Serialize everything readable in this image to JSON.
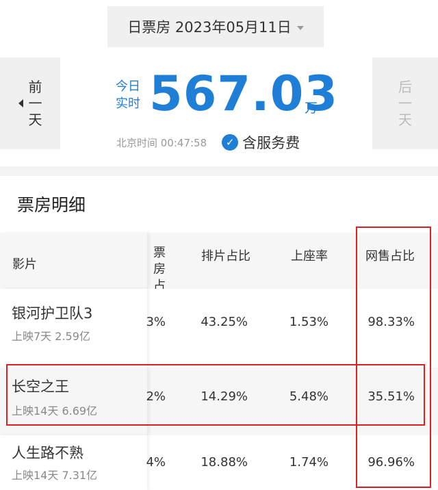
{
  "header": {
    "date_label": "日票房 2023年05月11日"
  },
  "nav": {
    "prev": [
      "前",
      "一",
      "天"
    ],
    "next": [
      "后",
      "一",
      "天"
    ]
  },
  "realtime": {
    "label_line1": "今日",
    "label_line2": "实时",
    "value": "567.03",
    "unit": "万",
    "time": "北京时间 00:47:58",
    "fee_note": "含服务费"
  },
  "section": {
    "title": "票房明细"
  },
  "table": {
    "columns": {
      "film": "影片",
      "boxoffice_share_clipped_line1": "票房",
      "boxoffice_share_clipped_line2": "占比",
      "screening_share": "排片占比",
      "occupancy": "上座率",
      "online_share": "网售占比"
    },
    "rows": [
      {
        "name": "银河护卫队3",
        "sub": "上映7天 2.59亿",
        "boxoffice_share_clipped": "3%",
        "screening_share": "43.25%",
        "occupancy": "1.53%",
        "online_share": "98.33%"
      },
      {
        "name": "长空之王",
        "sub": "上映14天 6.69亿",
        "boxoffice_share_clipped": "2%",
        "screening_share": "14.29%",
        "occupancy": "5.48%",
        "online_share": "35.51%"
      },
      {
        "name": "人生路不熟",
        "sub": "上映14天 7.31亿",
        "boxoffice_share_clipped": "4%",
        "screening_share": "18.88%",
        "occupancy": "1.74%",
        "online_share": "96.96%"
      }
    ]
  },
  "colors": {
    "accent": "#1f7ed6",
    "highlight": "#e02020"
  }
}
